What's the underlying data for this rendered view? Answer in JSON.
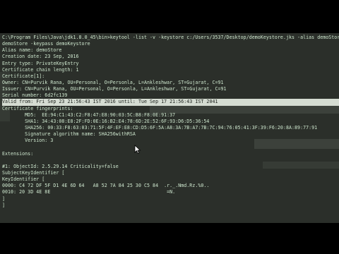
{
  "console": {
    "lines": [
      "C:\\Program Files\\Java\\jdk1.8.0_45\\bin>keytool -list -v -keystore c:/Users/3537/Desktop/demoKeystore.jks -alias demoStore -keypass demoKeystore",
      "demoStore -keypass demoKeystore",
      "Alias name: demoStore",
      "Creation date: 23 Sep, 2016",
      "Entry type: PrivateKeyEntry",
      "Certificate chain length: 1",
      "Certificate[1]:",
      "Owner: CN=Purvik Rana, OU=Personal, O=Personla, L=Ankleshwar, ST=Gujarat, C=91",
      "Issuer: CN=Purvik Rana, OU=Personal, O=Personla, L=Ankleshwar, ST=Gujarat, C=91",
      "Serial number: 6d2fc139",
      "Valid from: Fri Sep 23 21:56:43 IST 2016 until: Tue Sep 17 21:56:43 IST 2041",
      "Certificate fingerprints:",
      "        MD5:  EE:94:C1:43:C2:F8:47:E8:90:03:5C:B8:F8:0E:91:37",
      "        SHA1: 34:43:08:E8:2F:FD:0E:16:B2:E4:78:6D:2E:52:6F:93:D6:D5:36:54",
      "        SHA256: 00:33:F8:63:03:71:5F:4F:EF:E8:CD:D5:6F:5A:A8:3A:7B:A7:7B:7C:94:76:05:41:3F:39:F6:20:8A:89:77:91",
      "        Signature algorithm name: SHA256withRSA",
      "        Version: 3",
      "",
      "Extensions:",
      "",
      "#1: ObjectId: 2.5.29.14 Criticality=false",
      "SubjectKeyIdentifier [",
      "KeyIdentifier [",
      "0000: C4 72 DF 5F D1 4E 6D 64   A8 52 7A 84 25 30 C5 84  .r._.Nmd.Rz.%0..",
      "0010: 20 3D 4E 8E                                         =N.",
      "]",
      "]"
    ]
  },
  "colors": {
    "console_bg": "#2b2f2a",
    "text": "#cfe8cf",
    "selection_bg": "#d5dcd2",
    "letterbox": "#000000"
  },
  "icons": {
    "cursor": "mouse-pointer-icon"
  }
}
